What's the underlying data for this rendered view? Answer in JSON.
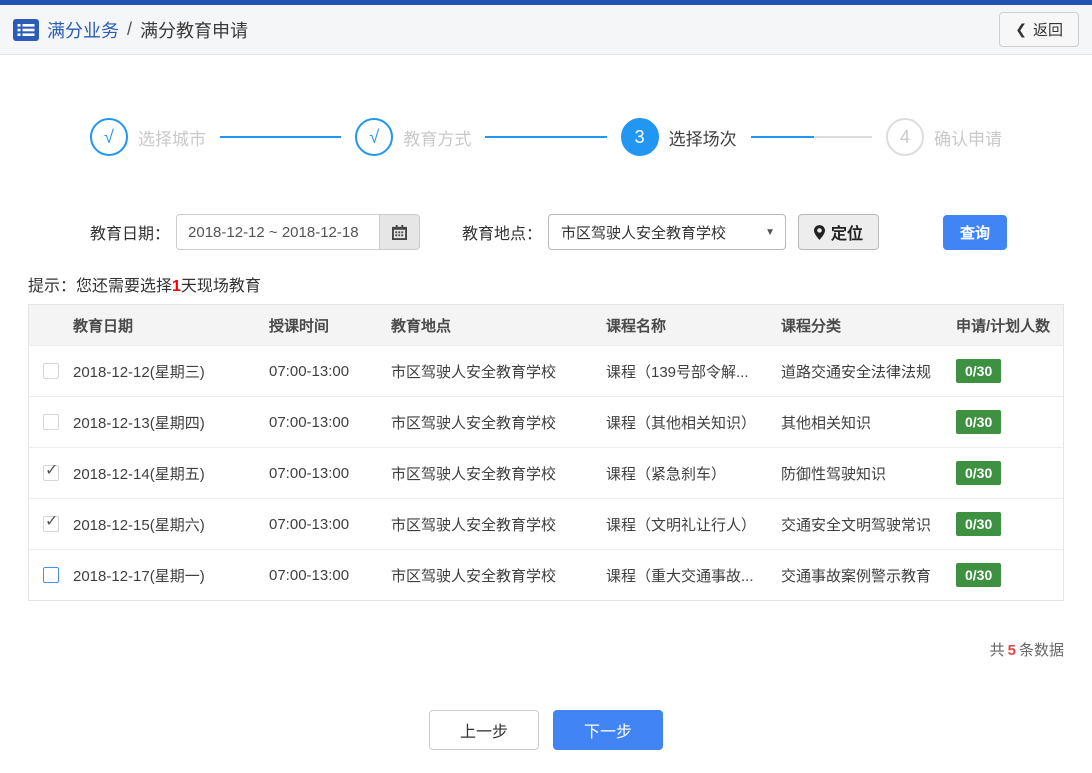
{
  "topbar": {
    "breadcrumb_primary": "满分业务",
    "breadcrumb_separator": "/",
    "breadcrumb_secondary": "满分教育申请",
    "back_label": "返回"
  },
  "steps": [
    {
      "marker": "√",
      "label": "选择城市",
      "state": "done"
    },
    {
      "marker": "√",
      "label": "教育方式",
      "state": "done"
    },
    {
      "marker": "3",
      "label": "选择场次",
      "state": "active"
    },
    {
      "marker": "4",
      "label": "确认申请",
      "state": "pending"
    }
  ],
  "filters": {
    "date_label": "教育日期：",
    "date_value": "2018-12-12 ~ 2018-12-18",
    "location_label": "教育地点：",
    "location_value": "市区驾驶人安全教育学校",
    "locate_label": "定位",
    "search_label": "查询"
  },
  "tip": {
    "prefix": "提示：您还需要选择",
    "highlight": "1",
    "suffix": "天现场教育"
  },
  "table": {
    "headers": [
      "教育日期",
      "授课时间",
      "教育地点",
      "课程名称",
      "课程分类",
      "申请/计划人数"
    ],
    "rows": [
      {
        "checked": false,
        "focus": false,
        "date": "2018-12-12(星期三)",
        "time": "07:00-13:00",
        "place": "市区驾驶人安全教育学校",
        "course": "课程（139号部令解...",
        "category": "道路交通安全法律法规",
        "quota": "0/30"
      },
      {
        "checked": false,
        "focus": false,
        "date": "2018-12-13(星期四)",
        "time": "07:00-13:00",
        "place": "市区驾驶人安全教育学校",
        "course": "课程（其他相关知识）",
        "category": "其他相关知识",
        "quota": "0/30"
      },
      {
        "checked": true,
        "focus": false,
        "date": "2018-12-14(星期五)",
        "time": "07:00-13:00",
        "place": "市区驾驶人安全教育学校",
        "course": "课程（紧急刹车）",
        "category": "防御性驾驶知识",
        "quota": "0/30"
      },
      {
        "checked": true,
        "focus": false,
        "date": "2018-12-15(星期六)",
        "time": "07:00-13:00",
        "place": "市区驾驶人安全教育学校",
        "course": "课程（文明礼让行人）",
        "category": "交通安全文明驾驶常识",
        "quota": "0/30"
      },
      {
        "checked": false,
        "focus": true,
        "date": "2018-12-17(星期一)",
        "time": "07:00-13:00",
        "place": "市区驾驶人安全教育学校",
        "course": "课程（重大交通事故...",
        "category": "交通事故案例警示教育",
        "quota": "0/30"
      }
    ]
  },
  "summary": {
    "prefix": "共",
    "count": "5",
    "suffix": "条数据"
  },
  "footer": {
    "prev_label": "上一步",
    "next_label": "下一步"
  },
  "icons": {
    "back_chevron": "❮",
    "dropdown_arrow": "▼",
    "checkmark": "✓"
  },
  "colors": {
    "topbar": "#2253b0",
    "accent": "#2196f3",
    "btn_blue": "#4184f3",
    "badge_green": "#3f9142",
    "tip_red": "#ff0000",
    "count_red": "#e64545"
  }
}
